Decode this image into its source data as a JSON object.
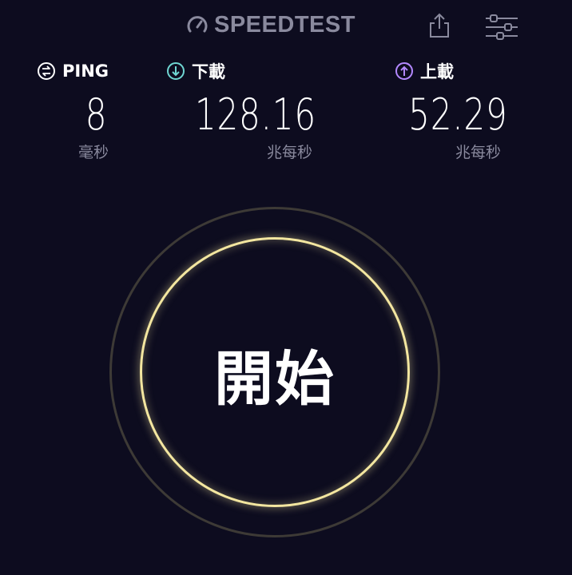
{
  "header": {
    "brand": "SPEEDTEST",
    "brand_icon": "speedometer-icon",
    "share_icon": "share-icon",
    "settings_icon": "sliders-icon"
  },
  "metrics": {
    "ping": {
      "label": "PING",
      "value": "8",
      "unit": "毫秒",
      "icon": "ping-icon",
      "color": "#ffffff"
    },
    "download": {
      "label": "下載",
      "value": "128.16",
      "unit": "兆每秒",
      "icon": "download-arrow-icon",
      "color": "#6fd6d2"
    },
    "upload": {
      "label": "上載",
      "value": "52.29",
      "unit": "兆每秒",
      "icon": "upload-arrow-icon",
      "color": "#b388ff"
    }
  },
  "start": {
    "label": "開始",
    "ring_color": "#f3e6a0"
  },
  "colors": {
    "background": "#0d0c1f",
    "muted_text": "#8a8a9e"
  }
}
